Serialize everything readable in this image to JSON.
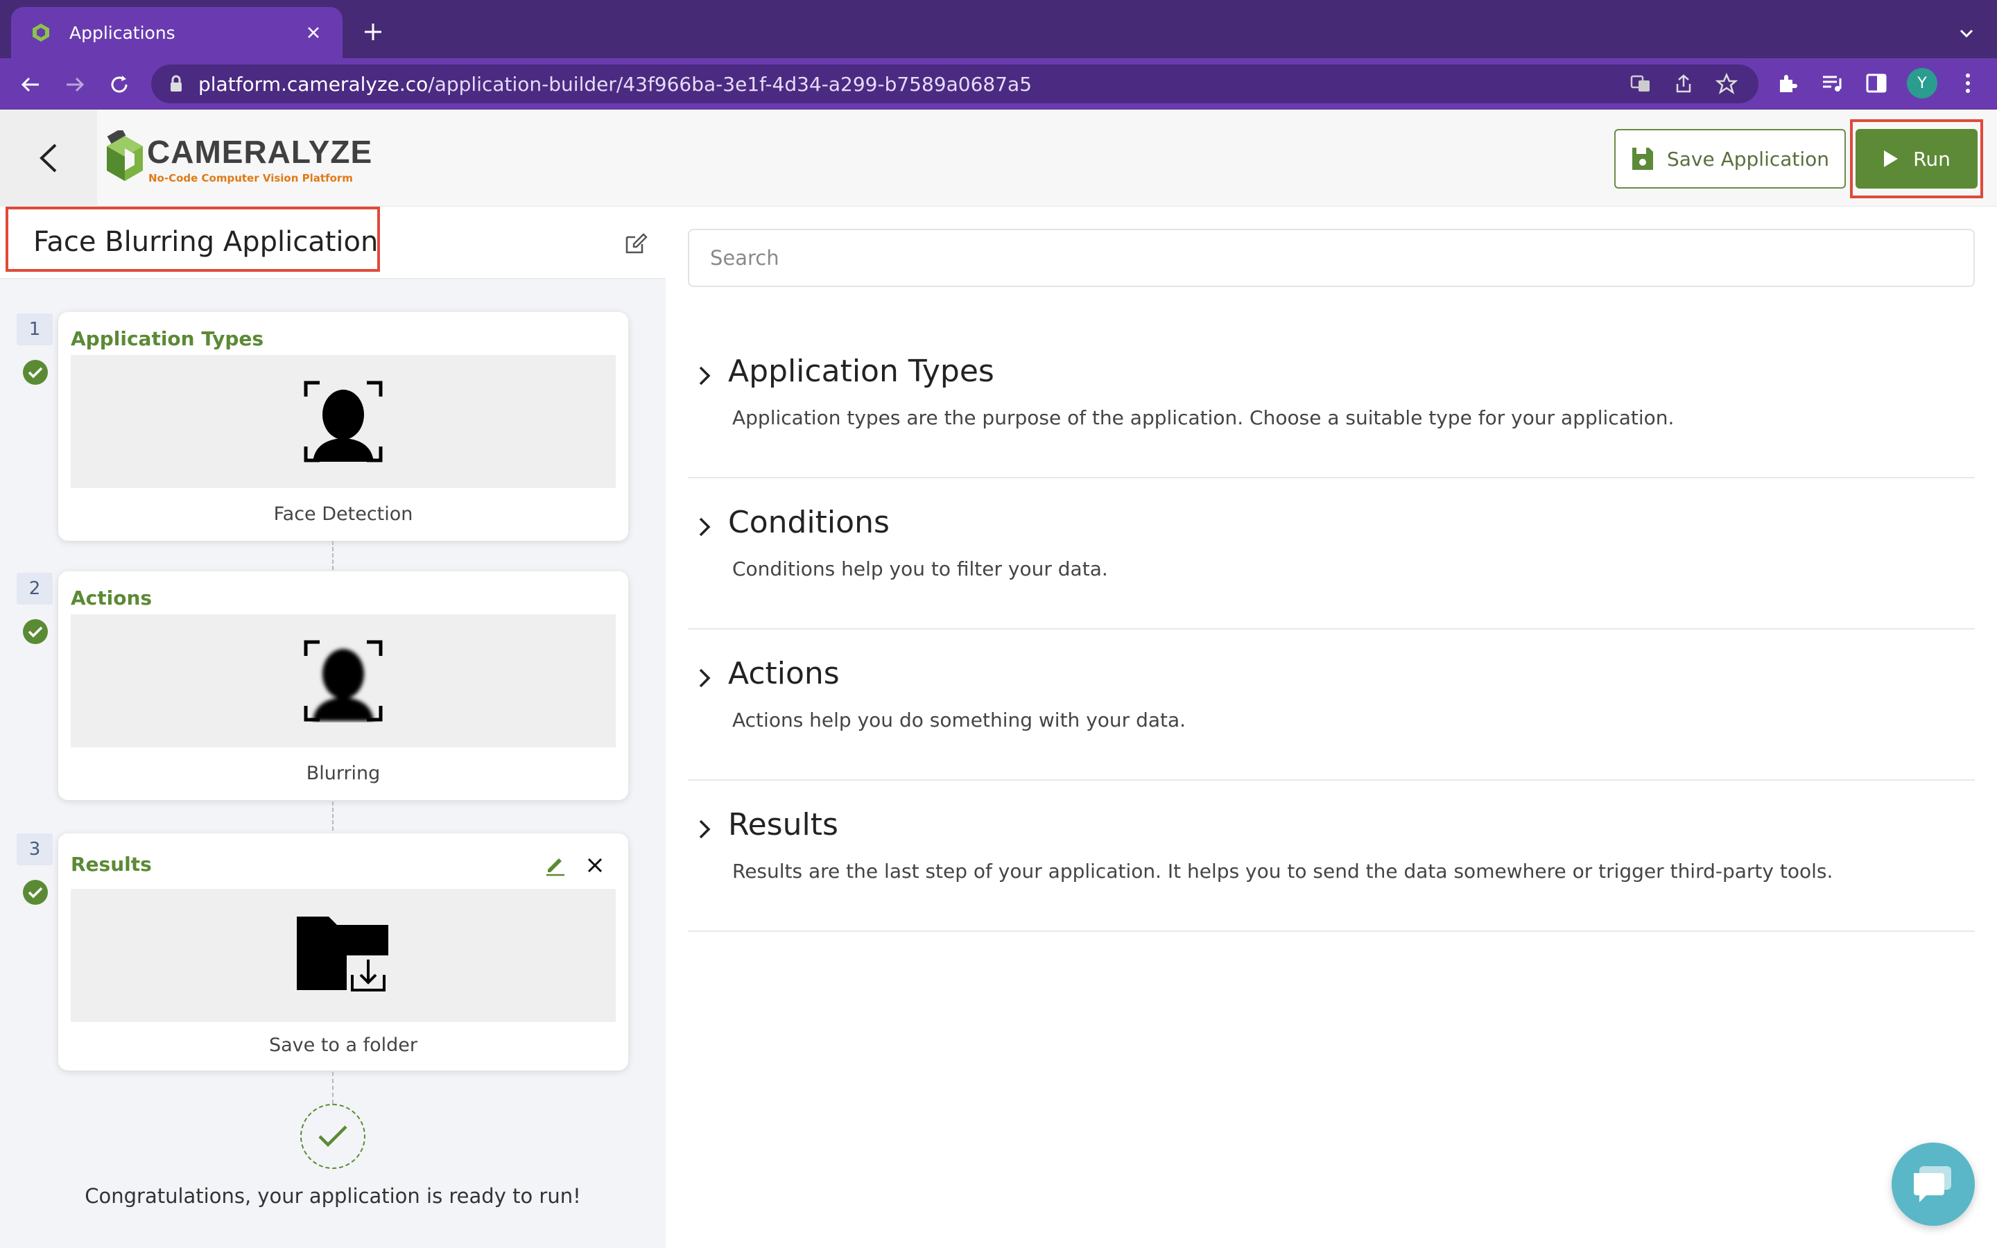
{
  "browser": {
    "tab_title": "Applications",
    "url_host": "platform.cameralyze.co",
    "url_path": "/application-builder/43f966ba-3e1f-4d34-a299-b7589a0687a5",
    "profile_initial": "Y"
  },
  "header": {
    "logo_text": "CAMERALYZE",
    "logo_tagline": "No-Code Computer Vision Platform",
    "save_label": "Save Application",
    "run_label": "Run"
  },
  "builder": {
    "app_title": "Face Blurring Application",
    "steps": [
      {
        "number": "1",
        "label": "Application Types",
        "caption": "Face Detection"
      },
      {
        "number": "2",
        "label": "Actions",
        "caption": "Blurring"
      },
      {
        "number": "3",
        "label": "Results",
        "caption": "Save to a folder"
      }
    ],
    "congrats": "Congratulations, your application is ready to run!"
  },
  "catalog": {
    "search_placeholder": "Search",
    "sections": [
      {
        "title": "Application Types",
        "desc": "Application types are the purpose of the application. Choose a suitable type for your application."
      },
      {
        "title": "Conditions",
        "desc": "Conditions help you to filter your data."
      },
      {
        "title": "Actions",
        "desc": "Actions help you do something with your data."
      },
      {
        "title": "Results",
        "desc": "Results are the last step of your application. It helps you to send the data somewhere or trigger third-party tools."
      }
    ]
  },
  "colors": {
    "accent_green": "#5c8a36",
    "browser_purple": "#6a3bb0",
    "highlight_red": "#e04a3a"
  },
  "icons": [
    "chevron-left-icon",
    "save-icon",
    "play-icon",
    "edit-icon",
    "check-circle-icon",
    "face-detection-icon",
    "face-blur-icon",
    "folder-download-icon",
    "chevron-right-icon",
    "chat-icon"
  ]
}
